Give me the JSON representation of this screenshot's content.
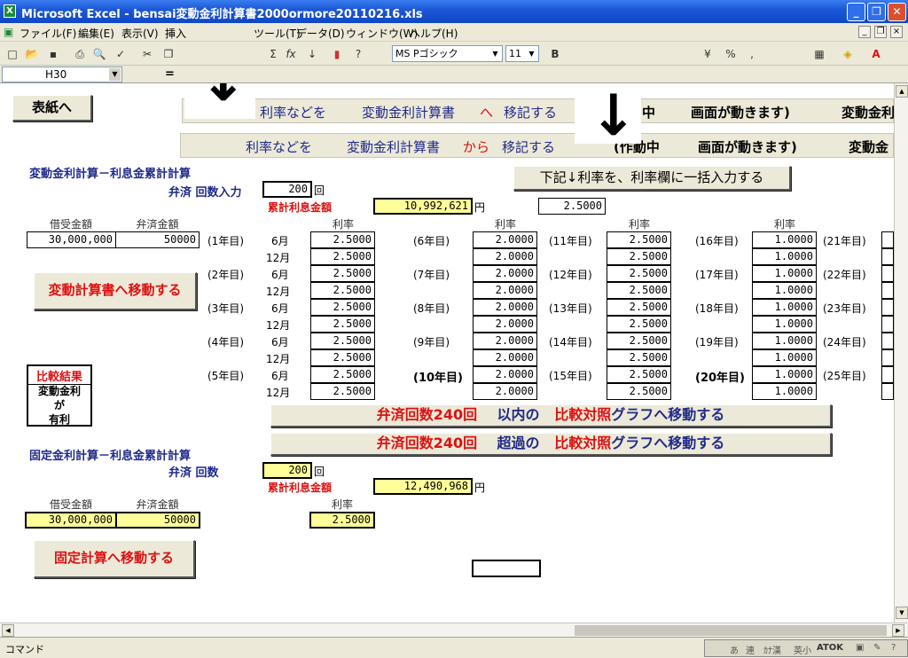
{
  "title_bar": {
    "title": "Microsoft Excel - bensai変動金利計算書2000ormore20110216.xls"
  },
  "menu": [
    {
      "label": "ファイル(F)"
    },
    {
      "label": "編集(E)"
    },
    {
      "label": "表示(V)"
    },
    {
      "label": "挿入"
    },
    {
      "label": "ツール(T)"
    },
    {
      "label": "データ(D)"
    },
    {
      "label": "ウィンドウ(W)"
    },
    {
      "label": "ヘルプ(H)"
    }
  ],
  "toolbar": {
    "font_name": "MS Pゴシック",
    "font_size": "11"
  },
  "formula_bar": {
    "cell_ref": "H30",
    "equals": "="
  },
  "annotations": {
    "arrow1_num": "8",
    "arrow2_num": "8"
  },
  "buttons": {
    "omote": "表紙へ",
    "move_hendo": "変動計算書へ移動する",
    "move_kotei": "固定計算へ移動する",
    "ikkatsu": "下記↓利率を、利率欄に一括入力する"
  },
  "banner1": {
    "a": "利率などを",
    "b": "変動金利計算書",
    "c": "へ",
    "d": "移記する",
    "e": "中",
    "f": "画面が動きます)",
    "g": "変動金利"
  },
  "banner2": {
    "a": "利率などを",
    "b": "変動金利計算書",
    "c": "から",
    "d": "移記する",
    "e": "(作動中",
    "f": "画面が動きます)",
    "g": "変動金"
  },
  "graph_btn1": {
    "a": "弁済回数240回",
    "b": "以内の",
    "c": "比較対照",
    "d": "グラフへ移動する"
  },
  "graph_btn2": {
    "a": "弁済回数240回",
    "b": "超過の",
    "c": "比較対照",
    "d": "グラフへ移動する"
  },
  "hendo": {
    "section_title": "変動金利計算－利息金累計計算",
    "kaisu_label": "弁済 回数入力",
    "kaisu": "200",
    "kai_unit": "回",
    "ruikei_label": "累計利息金額",
    "ruikei": "10,992,621",
    "yen": "円",
    "ikkatsu_rate": "2.5000",
    "kariire_hdr": "借受金額",
    "bensai_hdr": "弁済金額",
    "kariire": "30,000,000",
    "bensai": "50000"
  },
  "rate_header": "利率",
  "month_labels": [
    "6月",
    "12月"
  ],
  "rate_columns": [
    {
      "years": [
        "(1年目)",
        "(2年目)",
        "(3年目)",
        "(4年目)",
        "(5年目)"
      ],
      "rates": [
        "2.5000",
        "2.5000",
        "2.5000",
        "2.5000",
        "2.5000",
        "2.5000",
        "2.5000",
        "2.5000",
        "2.5000",
        "2.5000"
      ]
    },
    {
      "years": [
        "(6年目)",
        "(7年目)",
        "(8年目)",
        "(9年目)",
        "(10年目)"
      ],
      "rates": [
        "2.0000",
        "2.0000",
        "2.0000",
        "2.0000",
        "2.0000",
        "2.0000",
        "2.0000",
        "2.0000",
        "2.0000",
        "2.0000"
      ]
    },
    {
      "years": [
        "(11年目)",
        "(12年目)",
        "(13年目)",
        "(14年目)",
        "(15年目)"
      ],
      "rates": [
        "2.5000",
        "2.5000",
        "2.5000",
        "2.5000",
        "2.5000",
        "2.5000",
        "2.5000",
        "2.5000",
        "2.5000",
        "2.5000"
      ]
    },
    {
      "years": [
        "(16年目)",
        "(17年目)",
        "(18年目)",
        "(19年目)",
        "(20年目)"
      ],
      "rates": [
        "1.0000",
        "1.0000",
        "1.0000",
        "1.0000",
        "1.0000",
        "1.0000",
        "1.0000",
        "1.0000",
        "1.0000",
        "1.0000"
      ]
    },
    {
      "years": [
        "(21年目)",
        "(22年目)",
        "(23年目)",
        "(24年目)",
        "(25年目)"
      ]
    }
  ],
  "hikaku": {
    "title": "比較結果",
    "l1": "変動金利",
    "l2": "が",
    "l3": "有利"
  },
  "kotei": {
    "section_title": "固定金利計算－利息金累計計算",
    "kaisu_label": "弁済 回数",
    "kaisu": "200",
    "kai_unit": "回",
    "ruikei_label": "累計利息金額",
    "ruikei": "12,490,968",
    "yen": "円",
    "kariire_hdr": "借受金額",
    "bensai_hdr": "弁済金額",
    "rate_hdr": "利率",
    "kariire": "30,000,000",
    "bensai": "50000",
    "rate": "2.5000"
  },
  "status": {
    "text": "コマンド",
    "ime": [
      "あ",
      "連",
      "ｶﾅ漢",
      "英小",
      "ATOK"
    ]
  }
}
